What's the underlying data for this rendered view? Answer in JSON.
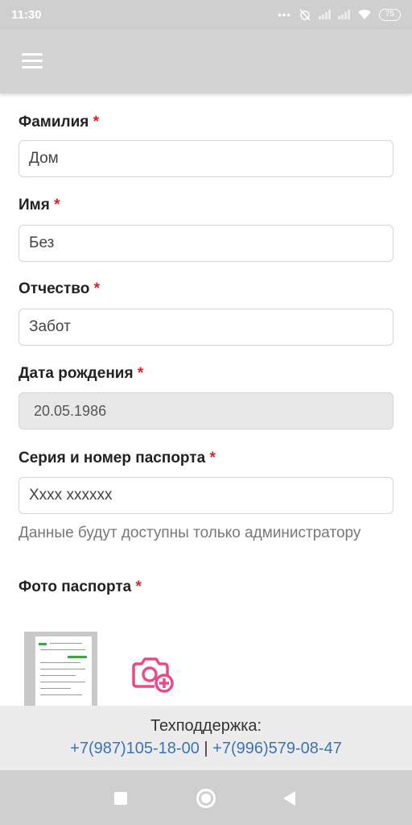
{
  "status_bar": {
    "time": "11:30",
    "battery": "75"
  },
  "form": {
    "required_mark": "*",
    "last_name": {
      "label": "Фамилия",
      "value": "Дом"
    },
    "first_name": {
      "label": "Имя",
      "value": "Без"
    },
    "patronymic": {
      "label": "Отчество",
      "value": "Забот"
    },
    "birth_date": {
      "label": "Дата рождения",
      "value": "20.05.1986"
    },
    "passport": {
      "label": "Серия и номер паспорта",
      "value": "Xxxx xxxxxx",
      "hint": "Данные будут доступны только администратору"
    },
    "passport_photo": {
      "label": "Фото паспорта"
    }
  },
  "footer": {
    "title": "Техподдержка:",
    "phone1": "+7(987)105-18-00",
    "separator": "|",
    "phone2": "+7(996)579-08-47"
  },
  "colors": {
    "accent": "#e84a8a",
    "link": "#3b72b8",
    "required": "#e02020"
  },
  "icons": [
    "menu-icon",
    "camera-add-icon",
    "nav-recents-icon",
    "nav-home-icon",
    "nav-back-icon"
  ]
}
